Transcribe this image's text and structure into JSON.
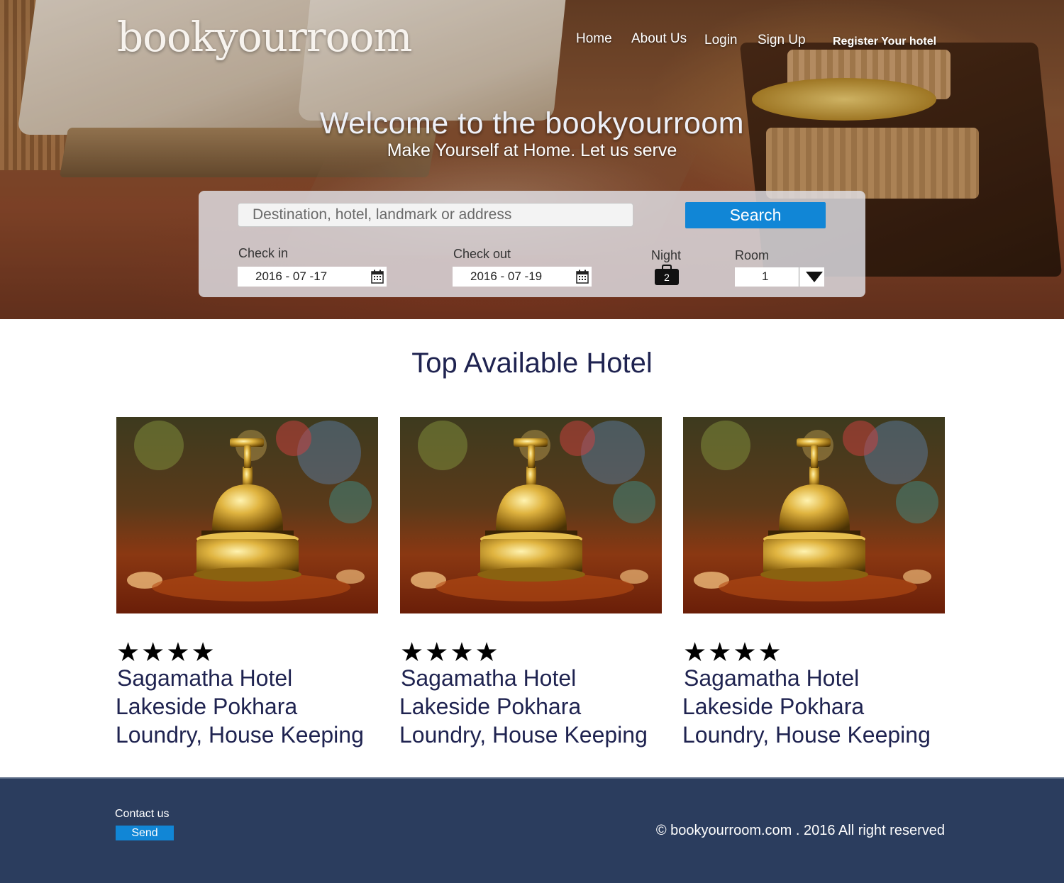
{
  "brand": {
    "logo": "bookyourroom"
  },
  "nav": {
    "home": "Home",
    "about": "About Us",
    "login": "Login",
    "signup": "Sign Up",
    "register": "Register Your hotel"
  },
  "hero": {
    "welcome": "Welcome to the bookyourroom",
    "tagline": "Make Yourself at Home. Let us serve"
  },
  "search": {
    "destination_placeholder": "Destination, hotel, landmark or address",
    "button": "Search",
    "checkin_label": "Check in",
    "checkin_value": "2016 - 07 -17",
    "checkout_label": "Check out",
    "checkout_value": "2016 - 07 -19",
    "night_label": "Night",
    "night_value": "2",
    "room_label": "Room",
    "room_value": "1",
    "icons": {
      "calendar": "calendar-icon",
      "night": "briefcase-icon",
      "dropdown": "triangle-down-icon"
    }
  },
  "section": {
    "title": "Top Available Hotel"
  },
  "hotels": [
    {
      "stars": "★★★★",
      "rating": 4,
      "name": "Sagamatha Hotel",
      "location": "Lakeside Pokhara",
      "services": "Loundry, House Keeping",
      "image": "service-bell-photo"
    },
    {
      "stars": "★★★★",
      "rating": 4,
      "name": "Sagamatha Hotel",
      "location": "Lakeside Pokhara",
      "services": "Loundry, House Keeping",
      "image": "service-bell-photo"
    },
    {
      "stars": "★★★★",
      "rating": 4,
      "name": "Sagamatha Hotel",
      "location": "Lakeside Pokhara",
      "services": "Loundry, House Keeping",
      "image": "service-bell-photo"
    }
  ],
  "footer": {
    "contact": "Contact us",
    "send": "Send",
    "copyright": "© bookyourroom.com . 2016 All right reserved"
  },
  "colors": {
    "accent": "#1186d6",
    "footer_bg": "#2b3d5e",
    "heading": "#1f2350"
  }
}
